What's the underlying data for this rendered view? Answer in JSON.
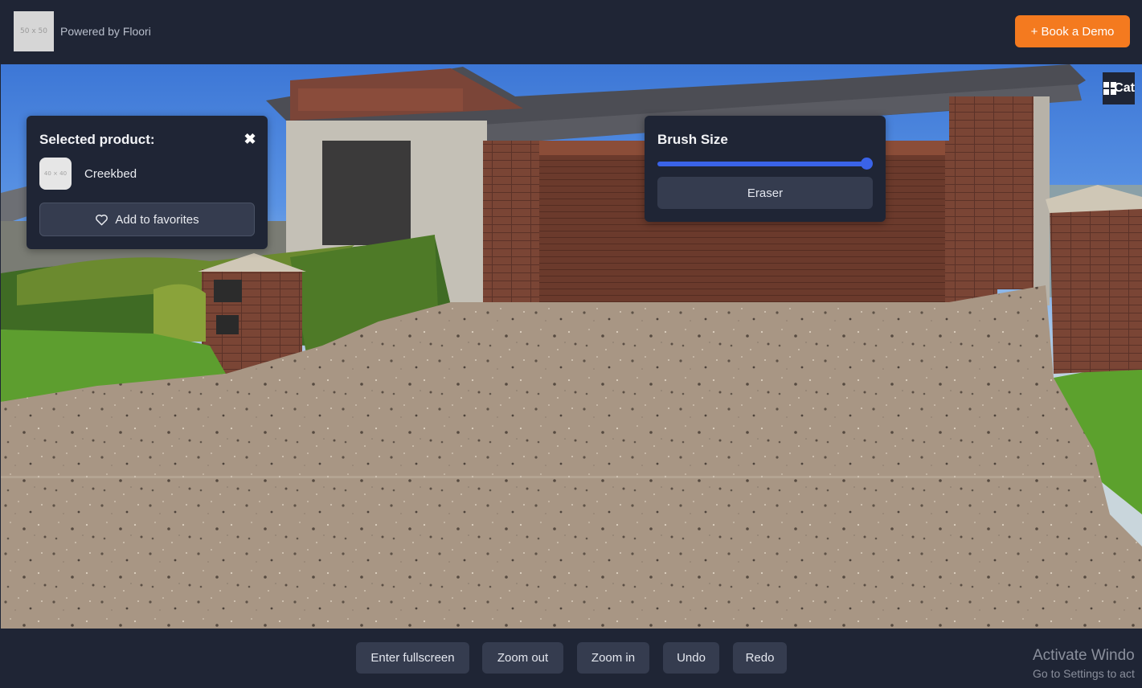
{
  "header": {
    "logo_placeholder": "50 x 50",
    "powered_by": "Powered by Floori",
    "book_demo_label": "+ Book a Demo"
  },
  "selected_product_panel": {
    "title": "Selected product:",
    "close_glyph": "✖",
    "thumbnail_placeholder": "40 × 40",
    "product_name": "Creekbed",
    "add_favorites_label": "Add to favorites"
  },
  "brush_panel": {
    "title": "Brush Size",
    "brush_size_fraction": 1.0,
    "eraser_label": "Eraser"
  },
  "catalog_button": {
    "label_visible": "Cat",
    "icon": "grid-icon"
  },
  "controls": {
    "fullscreen_label": "Enter fullscreen",
    "zoom_out_label": "Zoom out",
    "zoom_in_label": "Zoom in",
    "undo_label": "Undo",
    "redo_label": "Redo"
  },
  "os_watermark": {
    "line1": "Activate Windo",
    "line2": "Go to Settings to act"
  },
  "colors": {
    "accent_orange": "#f47a1f",
    "panel_bg": "#1f2535",
    "button_bg": "#353c4f",
    "slider_blue": "#3a63e8"
  }
}
